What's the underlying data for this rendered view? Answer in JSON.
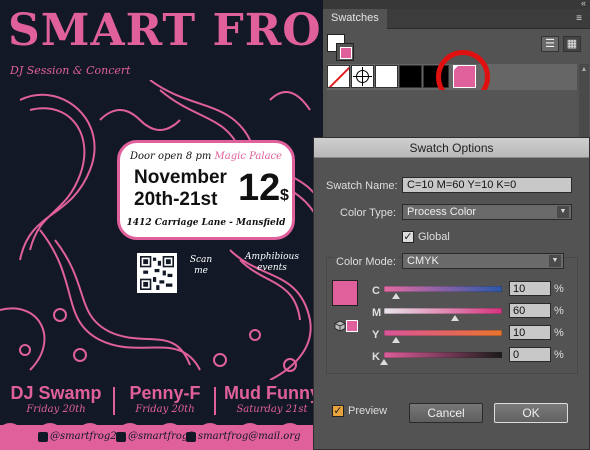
{
  "poster": {
    "title": "SMART FROG",
    "subtitle": "DJ Session & Concert",
    "door_text": "Door open 8 pm",
    "venue": "Magic Palace",
    "date_line1": "November",
    "date_line2": "20th-21st",
    "price": "12",
    "currency": "$",
    "address": "1412 Carriage Lane - Mansfield",
    "scan_text": "Scan me",
    "amphibious_text": "Amphibious events",
    "bands": [
      {
        "name": "DJ Swamp",
        "day": "Friday 20th"
      },
      {
        "name": "Penny-F",
        "day": "Friday 20th"
      },
      {
        "name": "Mud Funny",
        "day": "Saturday 21st"
      }
    ],
    "social": {
      "instagram": "@smartfrog2",
      "facebook": "@smartfrog2",
      "email": "smartfrog@mail.org"
    },
    "colors": {
      "accent": "#e0609c",
      "background": "#121826"
    }
  },
  "swatches_panel": {
    "tab_label": "Swatches",
    "collapse_glyph": "«",
    "menu_glyph": "≡",
    "swatches": [
      {
        "name": "[None]",
        "color": "none"
      },
      {
        "name": "[Registration]",
        "color": "registration"
      },
      {
        "name": "[Paper]",
        "color": "#ffffff"
      },
      {
        "name": "[Black]",
        "color": "#000000"
      },
      {
        "name": "Black",
        "color": "#000000"
      },
      {
        "name": "C=10 M=60 Y=10 K=0",
        "color": "#e0609c",
        "selected": true
      }
    ]
  },
  "dialog": {
    "title": "Swatch Options",
    "swatch_name_label": "Swatch Name:",
    "swatch_name_value": "C=10 M=60 Y=10 K=0",
    "color_type_label": "Color Type:",
    "color_type_value": "Process Color",
    "global_label": "Global",
    "global_checked": true,
    "color_mode_label": "Color Mode:",
    "color_mode_value": "CMYK",
    "channels": [
      {
        "label": "C",
        "value": "10",
        "unit": "%",
        "level": 0.1
      },
      {
        "label": "M",
        "value": "60",
        "unit": "%",
        "level": 0.6
      },
      {
        "label": "Y",
        "value": "10",
        "unit": "%",
        "level": 0.1
      },
      {
        "label": "K",
        "value": "0",
        "unit": "%",
        "level": 0.0
      }
    ],
    "preview_label": "Preview",
    "preview_checked": true,
    "cancel_label": "Cancel",
    "ok_label": "OK",
    "swatch_color": "#e0609c"
  }
}
